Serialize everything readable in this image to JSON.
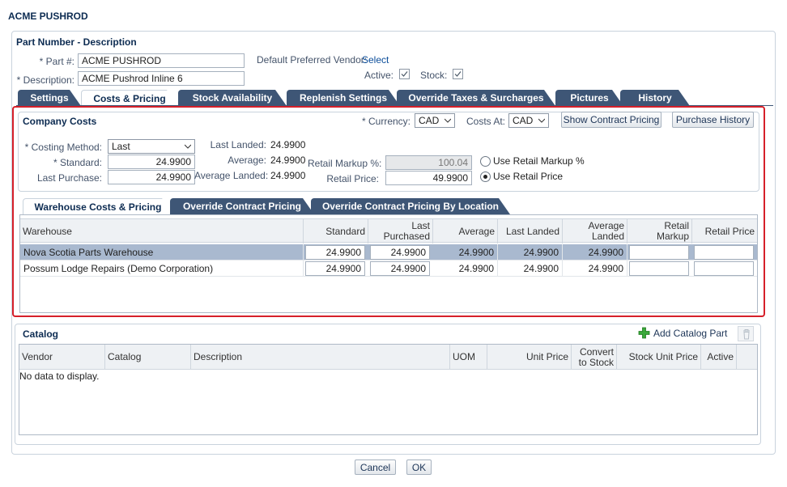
{
  "window": {
    "title": "ACME PUSHROD"
  },
  "part": {
    "section_title": "Part Number - Description",
    "part_no_label": "* Part #:",
    "part_no_value": "ACME PUSHROD",
    "description_label": "* Description:",
    "description_value": "ACME Pushrod Inline 6",
    "vendor_label": "Default Preferred Vendor:",
    "vendor_link": "Select",
    "active_label": "Active:",
    "active_checked": true,
    "stock_label": "Stock:",
    "stock_checked": true
  },
  "tabs": [
    {
      "label": "Settings"
    },
    {
      "label": "Costs & Pricing"
    },
    {
      "label": "Stock Availability"
    },
    {
      "label": "Replenish Settings"
    },
    {
      "label": "Override Taxes & Surcharges"
    },
    {
      "label": "Pictures"
    },
    {
      "label": "History"
    }
  ],
  "company_costs": {
    "title": "Company Costs",
    "currency_label": "* Currency:",
    "currency_value": "CAD",
    "costs_at_label": "Costs At:",
    "costs_at_value": "CAD",
    "show_contract_btn": "Show Contract Pricing",
    "purchase_history_btn": "Purchase History",
    "costing_method_label": "* Costing Method:",
    "costing_method_value": "Last",
    "standard_label": "* Standard:",
    "standard_value": "24.9900",
    "last_purchase_label": "Last Purchase:",
    "last_purchase_value": "24.9900",
    "last_landed_label": "Last Landed:",
    "last_landed_value": "24.9900",
    "average_label": "Average:",
    "average_value": "24.9900",
    "average_landed_label": "Average Landed:",
    "average_landed_value": "24.9900",
    "retail_markup_label": "Retail Markup %:",
    "retail_markup_value": "100.04",
    "retail_price_label": "Retail Price:",
    "retail_price_value": "49.9900",
    "use_markup_label": "Use Retail Markup %",
    "use_price_label": "Use Retail Price"
  },
  "sub_tabs": [
    {
      "label": "Warehouse Costs & Pricing"
    },
    {
      "label": "Override Contract Pricing"
    },
    {
      "label": "Override Contract Pricing By Location"
    }
  ],
  "warehouse_table": {
    "columns": {
      "warehouse": "Warehouse",
      "standard": "Standard",
      "last_purchased": "Last Purchased",
      "average": "Average",
      "last_landed": "Last Landed",
      "average_landed_1": "Average",
      "average_landed_2": "Landed",
      "retail_markup": "Retail Markup",
      "retail_price": "Retail Price"
    },
    "rows": [
      {
        "warehouse": "Nova Scotia Parts Warehouse",
        "standard": "24.9900",
        "last_purchased": "24.9900",
        "average": "24.9900",
        "last_landed": "24.9900",
        "average_landed": "24.9900"
      },
      {
        "warehouse": "Possum Lodge Repairs (Demo Corporation)",
        "standard": "24.9900",
        "last_purchased": "24.9900",
        "average": "24.9900",
        "last_landed": "24.9900",
        "average_landed": "24.9900"
      }
    ]
  },
  "catalog": {
    "title": "Catalog",
    "add_label": "Add Catalog Part",
    "columns": {
      "vendor": "Vendor",
      "catalog": "Catalog",
      "description": "Description",
      "uom": "UOM",
      "unit_price": "Unit Price",
      "convert_1": "Convert",
      "convert_2": "to Stock",
      "stock_unit_price": "Stock Unit Price",
      "active": "Active"
    },
    "empty_text": "No data to display."
  },
  "footer": {
    "cancel": "Cancel",
    "ok": "OK"
  },
  "colors": {
    "accent_red": "#d6202a",
    "tab_dark": "#3e5676",
    "title_blue": "#0d2c52",
    "selected_row": "#a9b9cf"
  }
}
